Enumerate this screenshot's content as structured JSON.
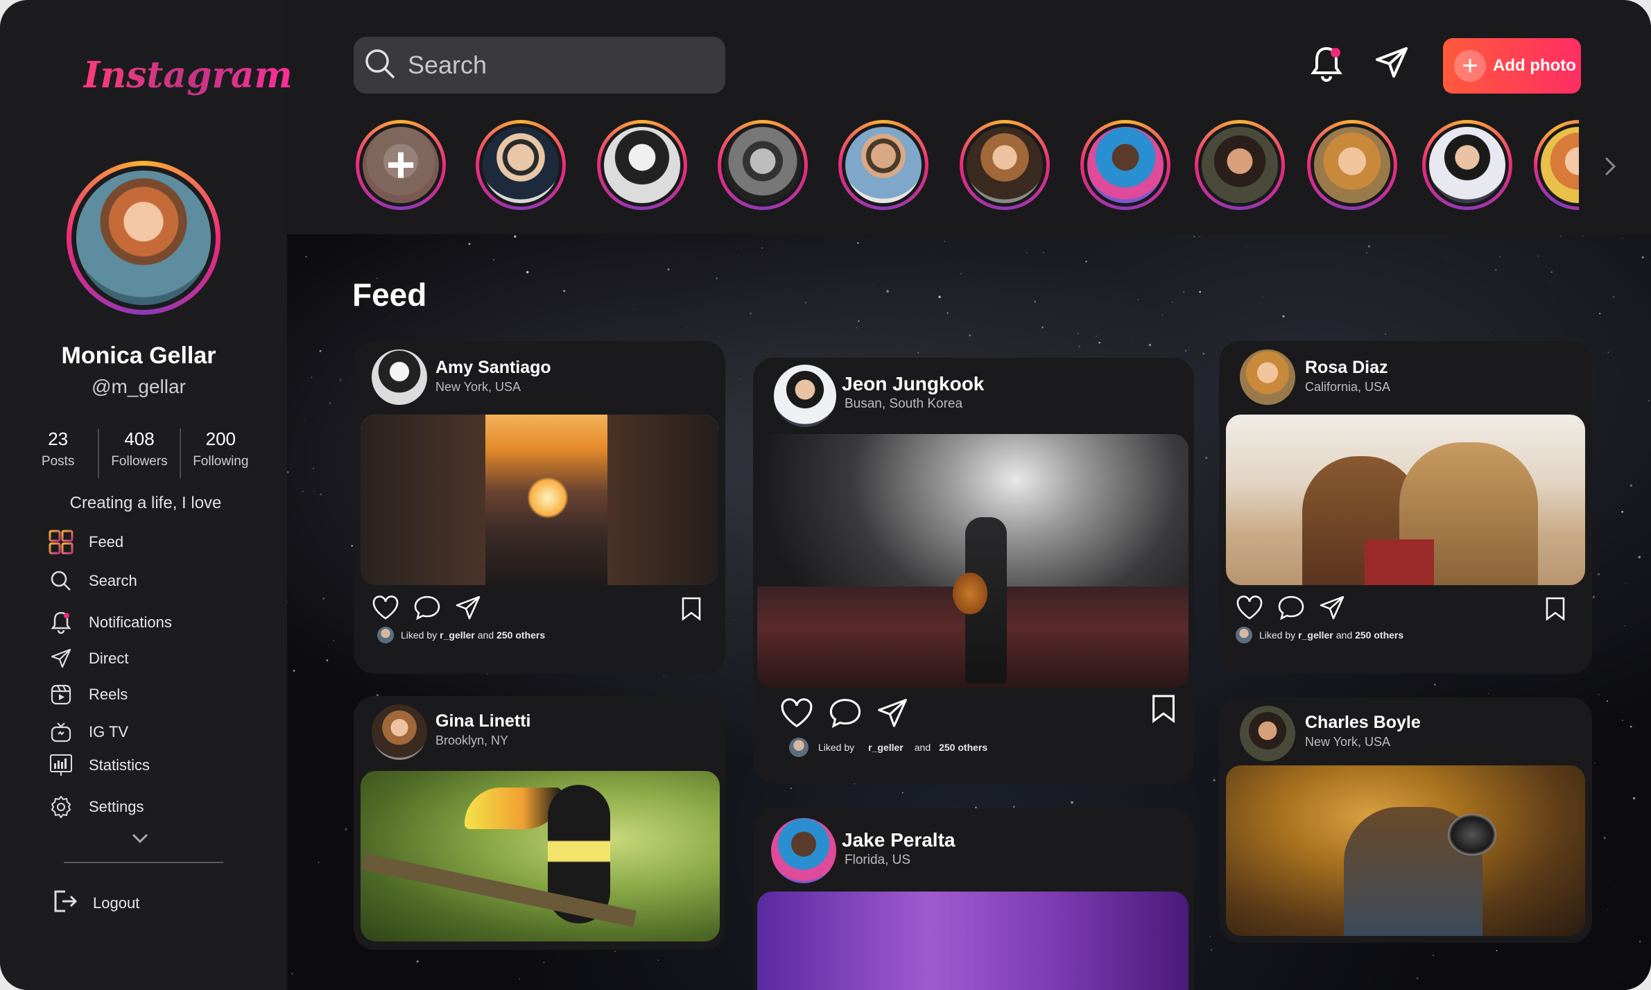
{
  "app": {
    "logo": "Instagram"
  },
  "profile": {
    "name": "Monica Gellar",
    "handle": "@m_gellar",
    "stats": [
      {
        "value": "23",
        "label": "Posts"
      },
      {
        "value": "408",
        "label": "Followers"
      },
      {
        "value": "200",
        "label": "Following"
      }
    ],
    "bio": "Creating a life, I love"
  },
  "nav": [
    {
      "label": "Feed",
      "icon": "grid-icon"
    },
    {
      "label": "Search",
      "icon": "search-icon"
    },
    {
      "label": "Notifications",
      "icon": "bell-icon"
    },
    {
      "label": "Direct",
      "icon": "send-icon"
    },
    {
      "label": "Reels",
      "icon": "reels-icon"
    },
    {
      "label": "IG TV",
      "icon": "tv-icon"
    },
    {
      "label": "Statistics",
      "icon": "chart-icon"
    },
    {
      "label": "Settings",
      "icon": "gear-icon"
    }
  ],
  "logout": {
    "label": "Logout"
  },
  "top": {
    "search_placeholder": "Search",
    "add_photo_label": "Add photo"
  },
  "feed": {
    "title": "Feed",
    "posts": [
      {
        "user": "Amy Santiago",
        "location": "New York, USA",
        "liked_prefix": "Liked by",
        "liked_user": "r_geller",
        "liked_and": "and",
        "liked_others": "250 others"
      },
      {
        "user": "Jeon Jungkook",
        "location": "Busan, South Korea",
        "liked_prefix": "Liked by",
        "liked_user": "r_geller",
        "liked_and": "and",
        "liked_others": "250 others"
      },
      {
        "user": "Rosa Diaz",
        "location": "California, USA",
        "liked_prefix": "Liked by",
        "liked_user": "r_geller",
        "liked_and": "and",
        "liked_others": "250 others"
      },
      {
        "user": "Gina Linetti",
        "location": "Brooklyn, NY"
      },
      {
        "user": "Jake Peralta",
        "location": "Florida, US"
      },
      {
        "user": "Charles Boyle",
        "location": "New York, USA"
      }
    ]
  },
  "colors": {
    "accent_gradient_start": "#ff5a3c",
    "accent_gradient_end": "#ff2e63",
    "story_ring": "#ee2a7b",
    "background": "#1a1a1c"
  }
}
